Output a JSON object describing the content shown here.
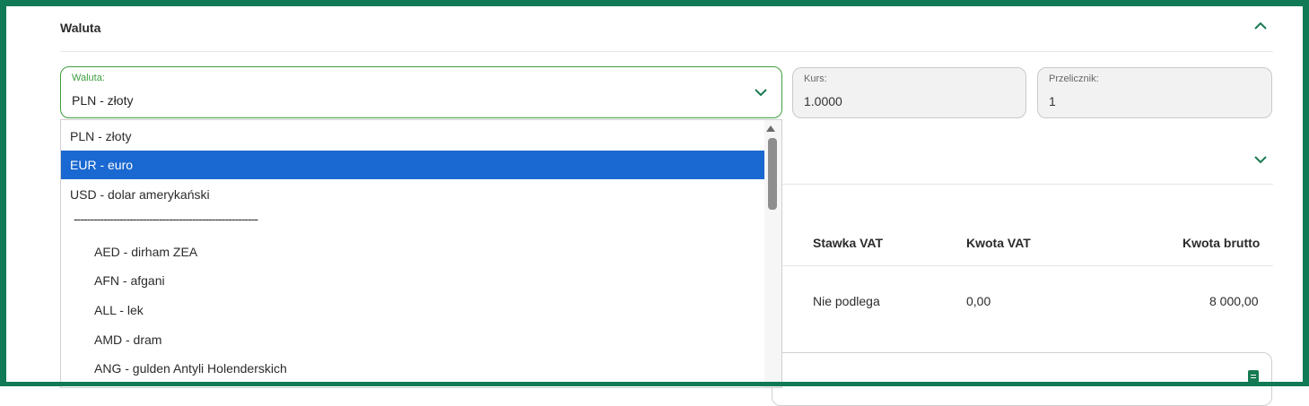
{
  "section": {
    "title": "Waluta"
  },
  "currency_field": {
    "label": "Waluta:",
    "value": "PLN - złoty"
  },
  "rate_field": {
    "label": "Kurs:",
    "value": "1.0000"
  },
  "converter_field": {
    "label": "Przelicznik:",
    "value": "1"
  },
  "dropdown": {
    "options": [
      "PLN - złoty",
      "EUR - euro",
      "USD - dolar amerykański",
      "--------------------------------------------------------",
      "AED - dirham ZEA",
      "AFN - afgani",
      "ALL - lek",
      "AMD - dram",
      "ANG - gulden Antyli Holenderskich"
    ],
    "selected_option": "EUR - euro"
  },
  "table": {
    "headers": {
      "vat_rate": "Stawka VAT",
      "vat_amount": "Kwota VAT",
      "gross": "Kwota brutto"
    },
    "row": {
      "vat_rate": "Nie podlega",
      "vat_amount": "0,00",
      "gross": "8 000,00"
    }
  },
  "colors": {
    "frame": "#0f7a55",
    "selected": "#1a68d1",
    "active_border": "#3f9f3f"
  },
  "icons": [
    "chevron-up-icon",
    "chevron-down-icon",
    "document-icon"
  ]
}
